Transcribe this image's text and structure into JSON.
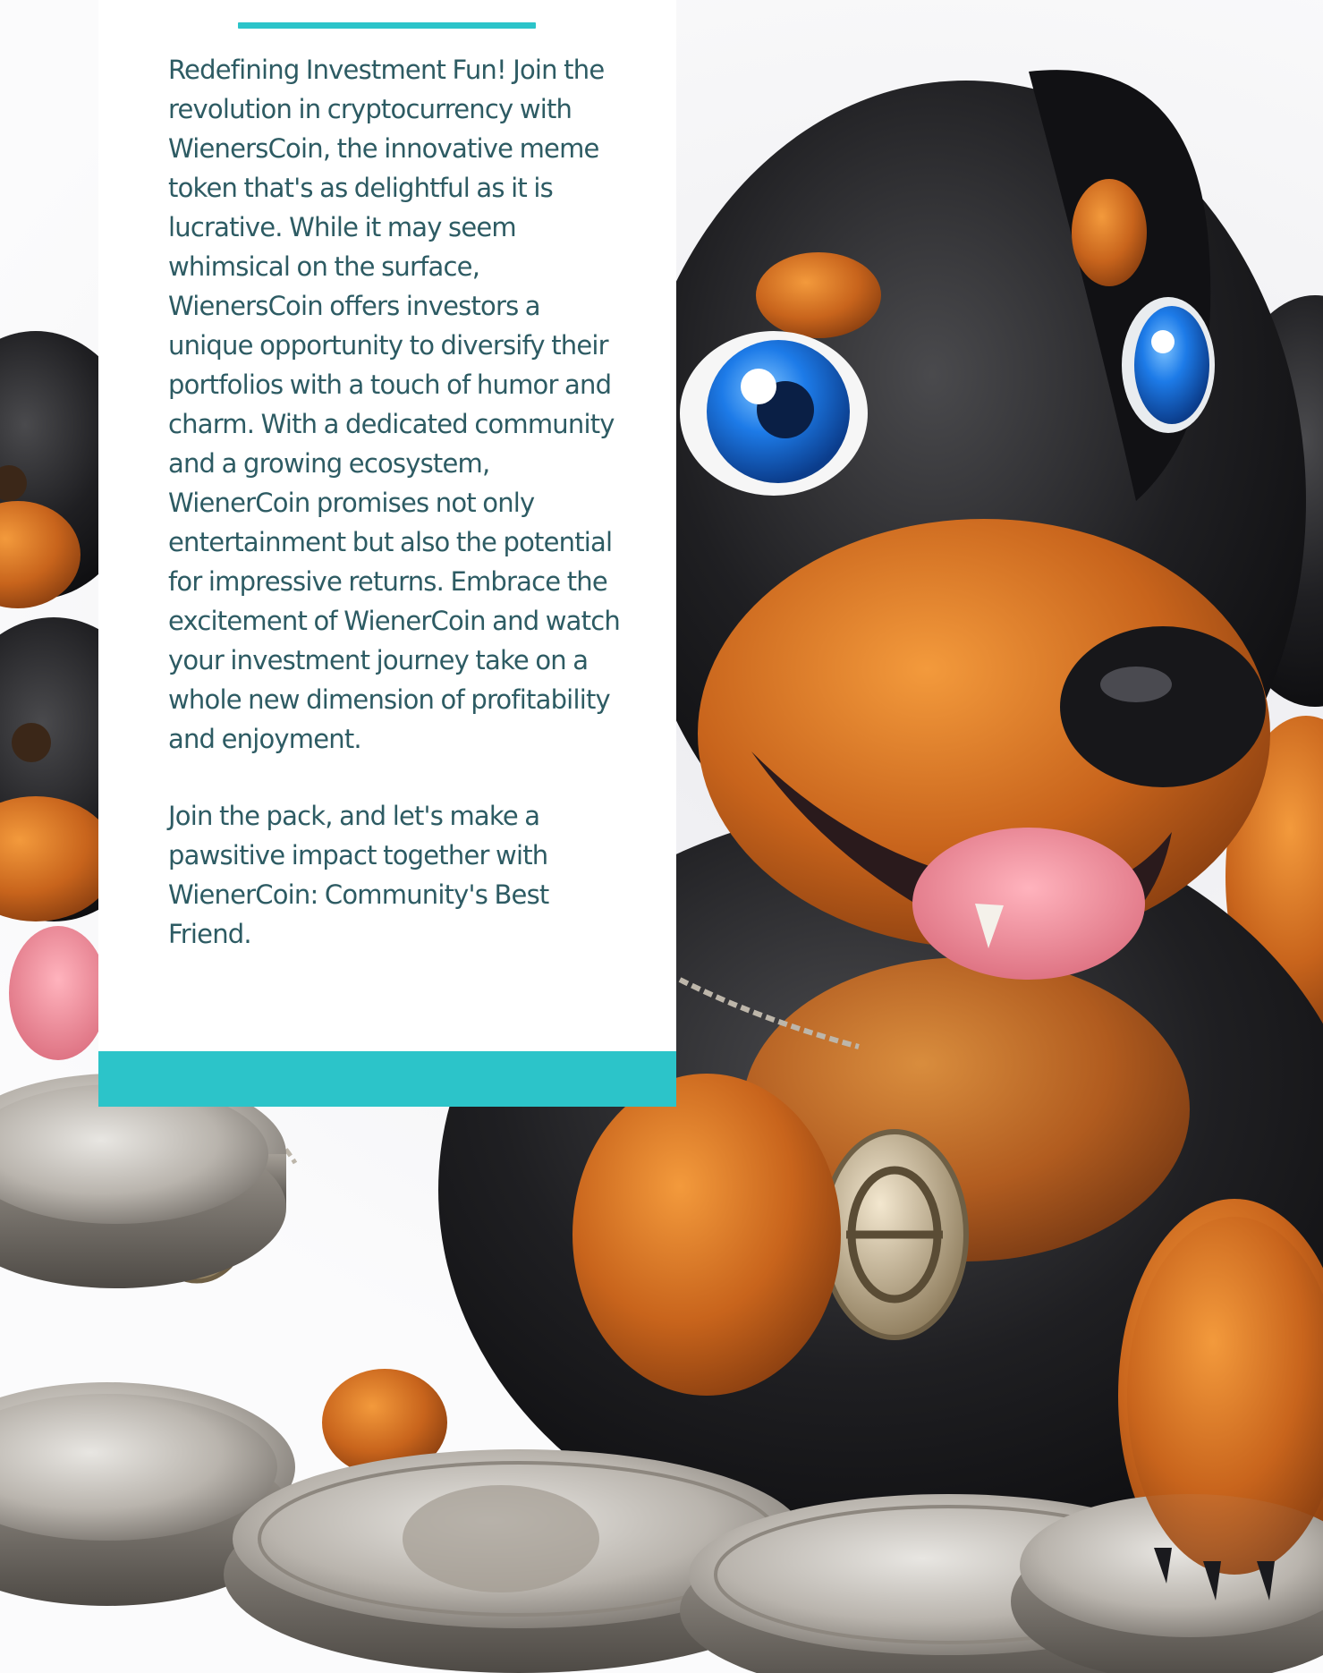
{
  "hero": {
    "image_desc_icon": "dachshund-puppies-with-coins-illustration"
  },
  "colors": {
    "accent": "#2cc4c9",
    "body_text": "#2d5b63",
    "card_bg": "#ffffff"
  },
  "about": {
    "paragraph_1": "Redefining Investment Fun! Join the revolution in cryptocurrency with WienersCoin, the innovative meme token that's as delightful as it is lucrative. While it may seem whimsical on the surface, WienersCoin offers investors a unique opportunity to diversify their portfolios with a touch of humor and charm. With a dedicated community and a growing ecosystem, WienerCoin promises not only entertainment but also the potential for impressive returns. Embrace the excitement of WienerCoin and watch your investment journey take on a whole new dimension of profitability and enjoyment.",
    "paragraph_2": "Join the pack, and let's make a pawsitive impact together with WienerCoin: Community's Best Friend."
  }
}
